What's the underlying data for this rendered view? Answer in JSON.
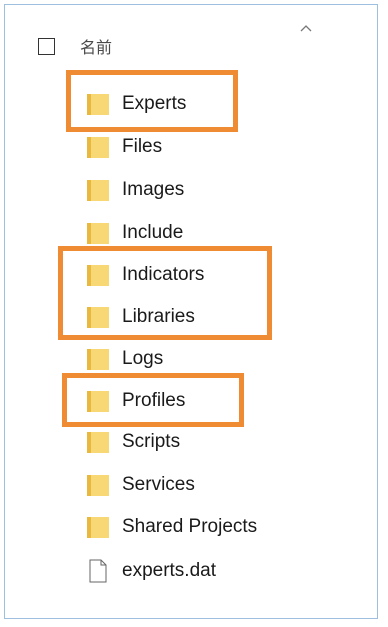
{
  "header": {
    "column_name": "名前",
    "sort_indicator": "chevron-up-icon"
  },
  "items": [
    {
      "label": "Experts",
      "type": "folder",
      "highlighted": true
    },
    {
      "label": "Files",
      "type": "folder",
      "highlighted": false
    },
    {
      "label": "Images",
      "type": "folder",
      "highlighted": false
    },
    {
      "label": "Include",
      "type": "folder",
      "highlighted": false
    },
    {
      "label": "Indicators",
      "type": "folder",
      "highlighted": true
    },
    {
      "label": "Libraries",
      "type": "folder",
      "highlighted": true
    },
    {
      "label": "Logs",
      "type": "folder",
      "highlighted": false
    },
    {
      "label": "Profiles",
      "type": "folder",
      "highlighted": true
    },
    {
      "label": "Scripts",
      "type": "folder",
      "highlighted": false
    },
    {
      "label": "Services",
      "type": "folder",
      "highlighted": false
    },
    {
      "label": "Shared Projects",
      "type": "folder",
      "highlighted": false
    },
    {
      "label": "experts.dat",
      "type": "file",
      "highlighted": false
    }
  ],
  "colors": {
    "highlight_border": "#ee8b33",
    "folder_fill": "#f8d775",
    "folder_shade": "#e8b93e",
    "pane_border": "#9fbfdf"
  }
}
